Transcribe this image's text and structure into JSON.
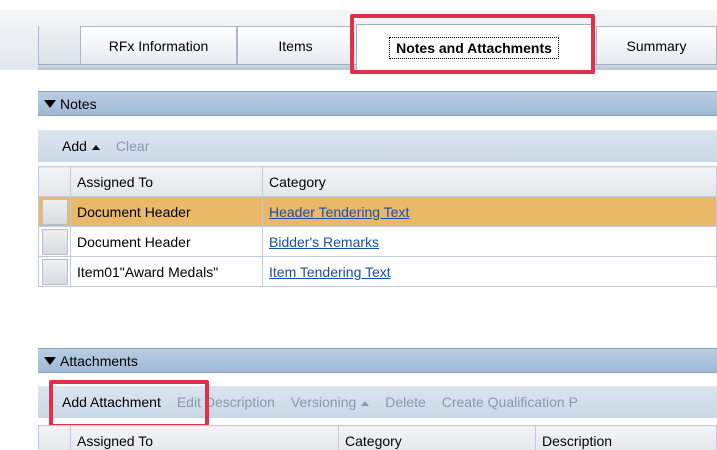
{
  "tabs": [
    {
      "label": "RFx Information"
    },
    {
      "label": "Items"
    },
    {
      "label": "Notes and Attachments",
      "active": true
    },
    {
      "label": "Summary"
    }
  ],
  "notes": {
    "header": "Notes",
    "toolbar": {
      "add_label": "Add",
      "clear_label": "Clear"
    },
    "columns": [
      "Assigned To",
      "Category"
    ],
    "rows": [
      {
        "assigned_to": "Document Header",
        "category": "Header Tendering Text",
        "selected": true
      },
      {
        "assigned_to": "Document Header",
        "category": "Bidder's Remarks"
      },
      {
        "assigned_to": "Item01\"Award Medals\"",
        "category": "Item Tendering Text"
      }
    ]
  },
  "attachments": {
    "header": "Attachments",
    "toolbar": {
      "add_attachment_label": "Add Attachment",
      "edit_description_label": "Edit Description",
      "versioning_label": "Versioning",
      "delete_label": "Delete",
      "create_qualification_label": "Create Qualification P"
    },
    "columns": [
      "Assigned To",
      "Category",
      "Description"
    ]
  },
  "colors": {
    "highlight_outline": "#e0304a",
    "selected_row": "#e9b868",
    "tray_header": "#a9c1da",
    "link": "#1a4fa3"
  }
}
